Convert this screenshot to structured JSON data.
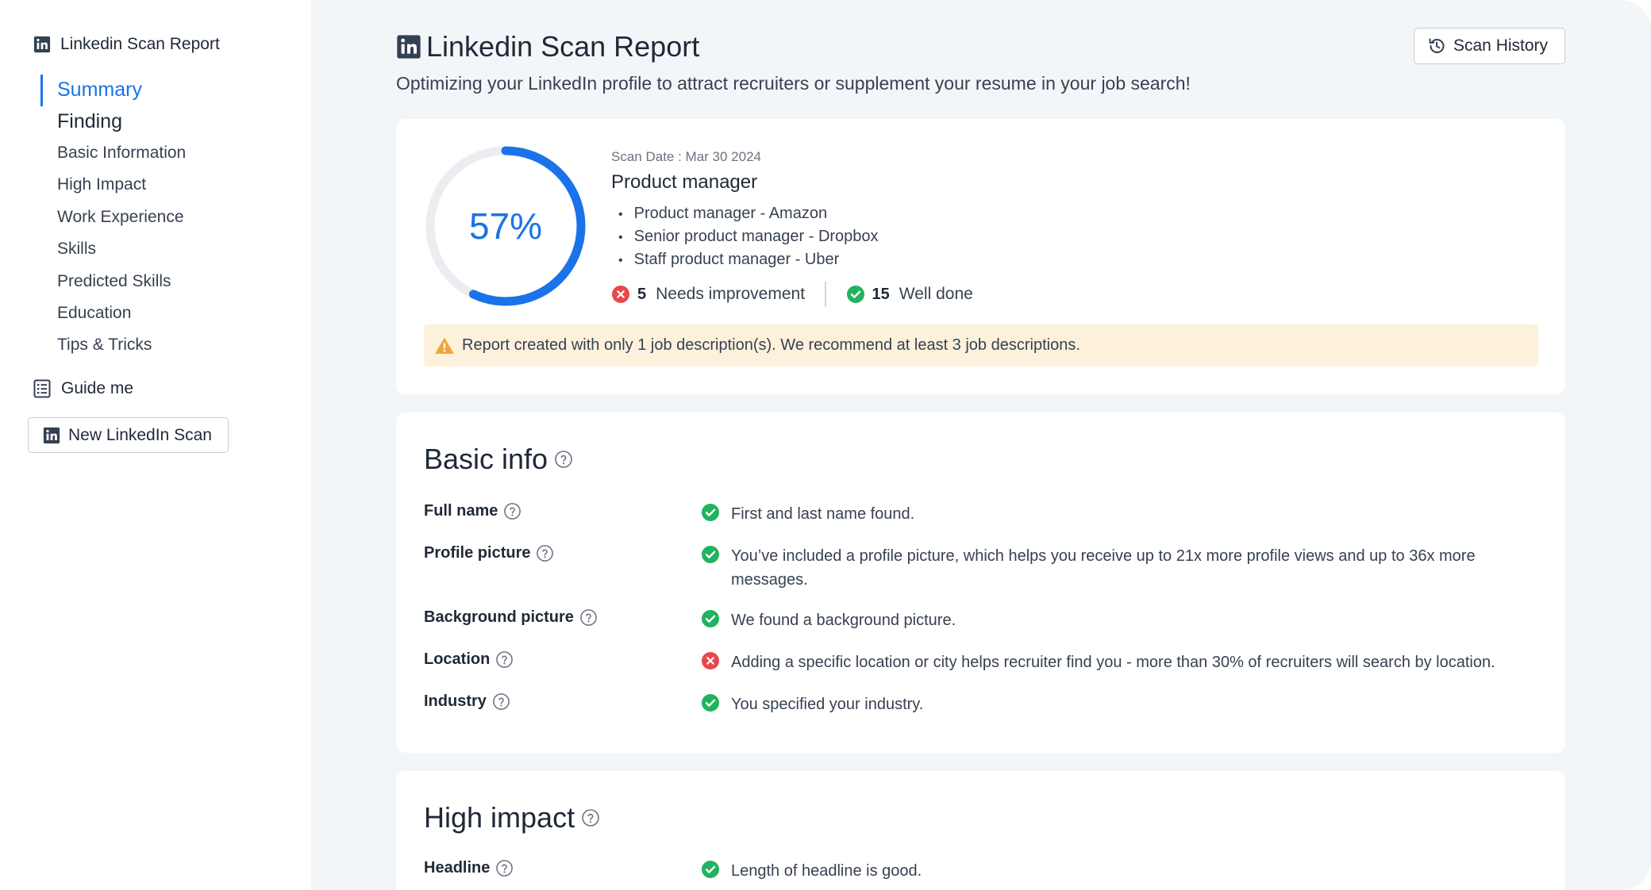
{
  "sidebar": {
    "title": "Linkedin Scan Report",
    "nav": {
      "summary": "Summary",
      "finding": "Finding",
      "items": [
        "Basic Information",
        "High Impact",
        "Work Experience",
        "Skills",
        "Predicted Skills",
        "Education",
        "Tips & Tricks"
      ]
    },
    "guide_label": "Guide me",
    "new_scan_label": "New LinkedIn Scan"
  },
  "header": {
    "title": "Linkedin Scan Report",
    "subtitle": "Optimizing your LinkedIn profile to attract recruiters or supplement your resume in your job search!",
    "history_label": "Scan History"
  },
  "summary": {
    "score_value": 57,
    "score_text": "57%",
    "scan_date": "Scan Date : Mar 30 2024",
    "job_title": "Product manager",
    "jobs": [
      "Product manager - Amazon",
      "Senior product manager - Dropbox",
      "Staff product manager - Uber"
    ],
    "needs_improvement_count": "5",
    "needs_improvement_label": "Needs improvement",
    "well_done_count": "15",
    "well_done_label": "Well done",
    "warning": "Report created with only 1 job description(s). We recommend at least 3 job descriptions."
  },
  "basic_info": {
    "title": "Basic info",
    "rows": [
      {
        "label": "Full name",
        "status": "pass",
        "text": "First and last name found."
      },
      {
        "label": "Profile picture",
        "status": "pass",
        "text": "You’ve included a profile picture, which helps you receive up to 21x more profile views and up to 36x more messages."
      },
      {
        "label": "Background picture",
        "status": "pass",
        "text": "We found a background picture."
      },
      {
        "label": "Location",
        "status": "fail",
        "text": "Adding a specific location or city helps recruiter find you - more than 30% of recruiters will search by location."
      },
      {
        "label": "Industry",
        "status": "pass",
        "text": "You specified your industry."
      }
    ]
  },
  "high_impact": {
    "title": "High impact",
    "rows": [
      {
        "label": "Headline",
        "status": "pass",
        "text": "Length of headline is good."
      }
    ]
  },
  "colors": {
    "accent": "#1a73e8",
    "success": "#22b35e",
    "error": "#e5484d",
    "warning_bg": "#fdf1dc",
    "warning_icon": "#f0a53a"
  },
  "icons": {
    "linkedin": "linkedin-icon",
    "guide": "checklist-icon",
    "history": "history-icon",
    "help": "question-circle-icon",
    "pass": "check-circle-icon",
    "fail": "x-circle-icon",
    "warning": "warning-triangle-icon"
  }
}
